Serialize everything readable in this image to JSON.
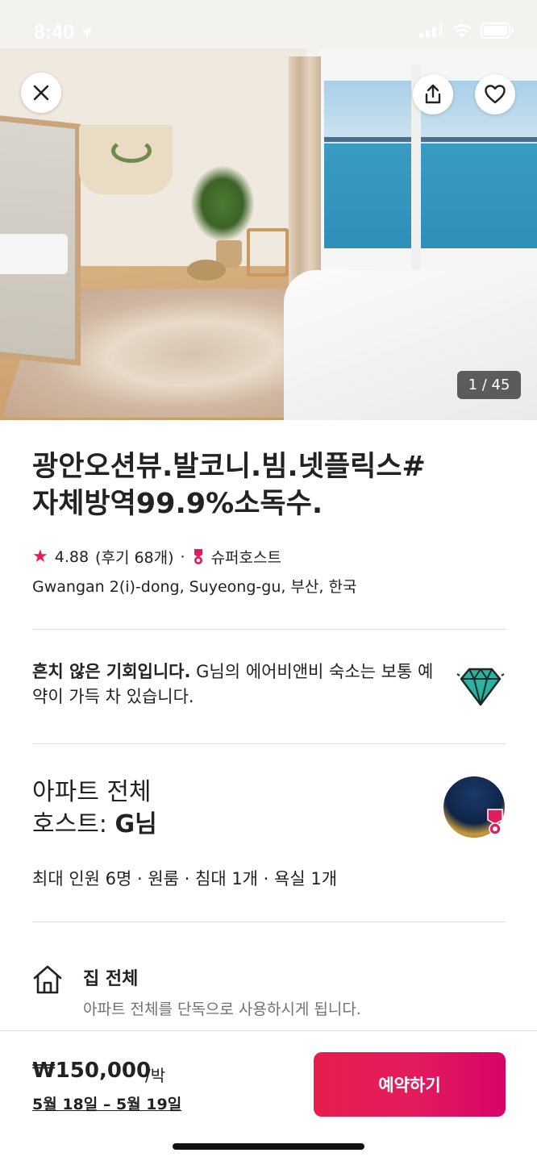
{
  "status_bar": {
    "time": "8:40",
    "icons": [
      "location-arrow-icon",
      "signal-icon",
      "wifi-icon",
      "battery-icon"
    ]
  },
  "hero": {
    "photo_counter": "1 / 45",
    "buttons": [
      "close-icon",
      "share-icon",
      "heart-icon"
    ]
  },
  "listing": {
    "title_line1": "광안오션뷰.발코니.빔.넷플릭스#",
    "title_line2": "자체방역99.9%소독수.",
    "rating": "4.88",
    "reviews": "(후기 68개)",
    "separator": "·",
    "superhost": "슈퍼호스트",
    "location": "Gwangan 2(i)-dong, Suyeong-gu, 부산, 한국"
  },
  "rare_find": {
    "bold": "흔치 않은 기회입니다.",
    "text": " G님의 에어비앤비 숙소는 보통 예약이 가득 차 있습니다."
  },
  "host": {
    "type": "아파트 전체",
    "label": "호스트: ",
    "name": "G님"
  },
  "capacity": "최대 인원 6명 · 원룸 · 침대 1개 · 욕실 1개",
  "feature": {
    "title": "집 전체",
    "desc": "아파트 전체를 단독으로 사용하시게 됩니다."
  },
  "booking": {
    "price": "₩150,000",
    "per_night": "/박",
    "dates": "5월 18일 – 5월 19일",
    "reserve_label": "예약하기"
  },
  "colors": {
    "accent": "#e31c5f",
    "text": "#222222",
    "muted": "#717171",
    "divider": "#dddddd"
  }
}
